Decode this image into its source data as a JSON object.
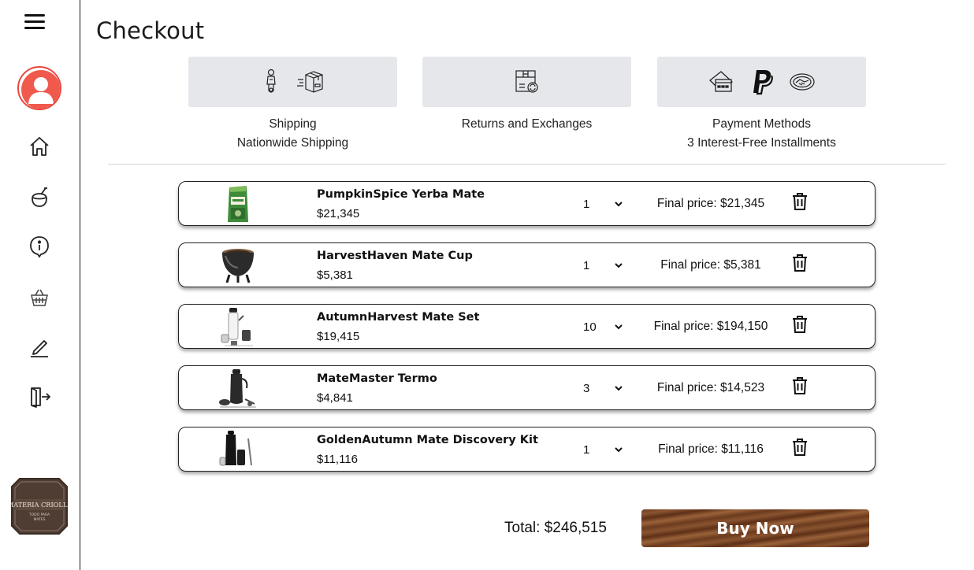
{
  "page": {
    "title": "Checkout"
  },
  "sidebar": {
    "icons": [
      "menu-icon",
      "avatar",
      "home-icon",
      "mate-icon",
      "info-icon",
      "basket-icon",
      "edit-icon",
      "logout-icon"
    ],
    "logo": {
      "line1": "MATERIA CRIOLLA",
      "line2": "TODO PARA MATES"
    }
  },
  "info": [
    {
      "title": "Shipping",
      "subtitle": "Nationwide Shipping"
    },
    {
      "title": "Returns and Exchanges",
      "subtitle": ""
    },
    {
      "title": "Payment Methods",
      "subtitle": "3 Interest-Free Installments"
    }
  ],
  "cart": {
    "items": [
      {
        "name": "PumpkinSpice Yerba Mate",
        "price": "$21,345",
        "qty": "1",
        "final": "Final price: $21,345",
        "thumb": "yerba-package"
      },
      {
        "name": "HarvestHaven Mate Cup",
        "price": "$5,381",
        "qty": "1",
        "final": "Final price: $5,381",
        "thumb": "mate-cup"
      },
      {
        "name": "AutumnHarvest Mate Set",
        "price": "$19,415",
        "qty": "10",
        "final": "Final price: $194,150",
        "thumb": "mate-set"
      },
      {
        "name": "MateMaster Termo",
        "price": "$4,841",
        "qty": "3",
        "final": "Final price: $14,523",
        "thumb": "thermos"
      },
      {
        "name": "GoldenAutumn Mate Discovery Kit",
        "price": "$11,116",
        "qty": "1",
        "final": "Final price: $11,116",
        "thumb": "discovery-kit"
      }
    ],
    "total": "Total: $246,515",
    "buy_label": "Buy Now"
  },
  "colors": {
    "avatar_ring": "#e8493f",
    "card_bg": "#e6e7eb",
    "button_wood": "#7a4526"
  }
}
